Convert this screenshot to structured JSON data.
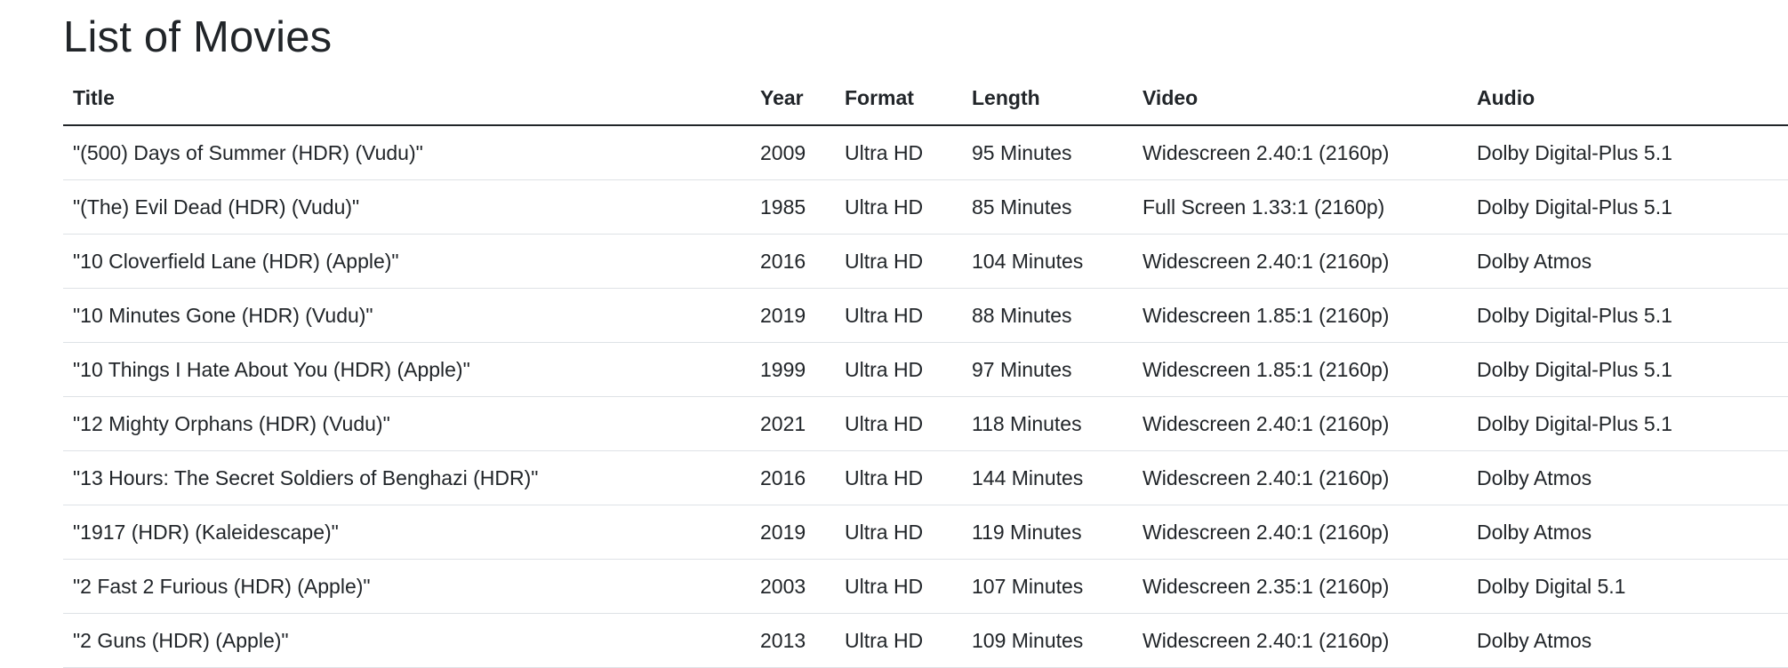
{
  "page": {
    "title": "List of Movies"
  },
  "table": {
    "headers": {
      "title": "Title",
      "year": "Year",
      "format": "Format",
      "length": "Length",
      "video": "Video",
      "audio": "Audio"
    },
    "rows": [
      {
        "title": "\"(500) Days of Summer (HDR) (Vudu)\"",
        "year": "2009",
        "format": "Ultra HD",
        "length": "95 Minutes",
        "video": "Widescreen 2.40:1 (2160p)",
        "audio": "Dolby Digital-Plus 5.1"
      },
      {
        "title": "\"(The) Evil Dead (HDR) (Vudu)\"",
        "year": "1985",
        "format": "Ultra HD",
        "length": "85 Minutes",
        "video": "Full Screen 1.33:1 (2160p)",
        "audio": "Dolby Digital-Plus 5.1"
      },
      {
        "title": "\"10 Cloverfield Lane (HDR) (Apple)\"",
        "year": "2016",
        "format": "Ultra HD",
        "length": "104 Minutes",
        "video": "Widescreen 2.40:1 (2160p)",
        "audio": "Dolby Atmos"
      },
      {
        "title": "\"10 Minutes Gone (HDR) (Vudu)\"",
        "year": "2019",
        "format": "Ultra HD",
        "length": "88 Minutes",
        "video": "Widescreen 1.85:1 (2160p)",
        "audio": "Dolby Digital-Plus 5.1"
      },
      {
        "title": "\"10 Things I Hate About You (HDR) (Apple)\"",
        "year": "1999",
        "format": "Ultra HD",
        "length": "97 Minutes",
        "video": "Widescreen 1.85:1 (2160p)",
        "audio": "Dolby Digital-Plus 5.1"
      },
      {
        "title": "\"12 Mighty Orphans (HDR) (Vudu)\"",
        "year": "2021",
        "format": "Ultra HD",
        "length": "118 Minutes",
        "video": "Widescreen 2.40:1 (2160p)",
        "audio": "Dolby Digital-Plus 5.1"
      },
      {
        "title": "\"13 Hours: The Secret Soldiers of Benghazi (HDR)\"",
        "year": "2016",
        "format": "Ultra HD",
        "length": "144 Minutes",
        "video": "Widescreen 2.40:1 (2160p)",
        "audio": "Dolby Atmos"
      },
      {
        "title": "\"1917 (HDR) (Kaleidescape)\"",
        "year": "2019",
        "format": "Ultra HD",
        "length": "119 Minutes",
        "video": "Widescreen 2.40:1 (2160p)",
        "audio": "Dolby Atmos"
      },
      {
        "title": "\"2 Fast 2 Furious (HDR) (Apple)\"",
        "year": "2003",
        "format": "Ultra HD",
        "length": "107 Minutes",
        "video": "Widescreen 2.35:1 (2160p)",
        "audio": "Dolby Digital 5.1"
      },
      {
        "title": "\"2 Guns (HDR) (Apple)\"",
        "year": "2013",
        "format": "Ultra HD",
        "length": "109 Minutes",
        "video": "Widescreen 2.40:1 (2160p)",
        "audio": "Dolby Atmos"
      }
    ]
  }
}
